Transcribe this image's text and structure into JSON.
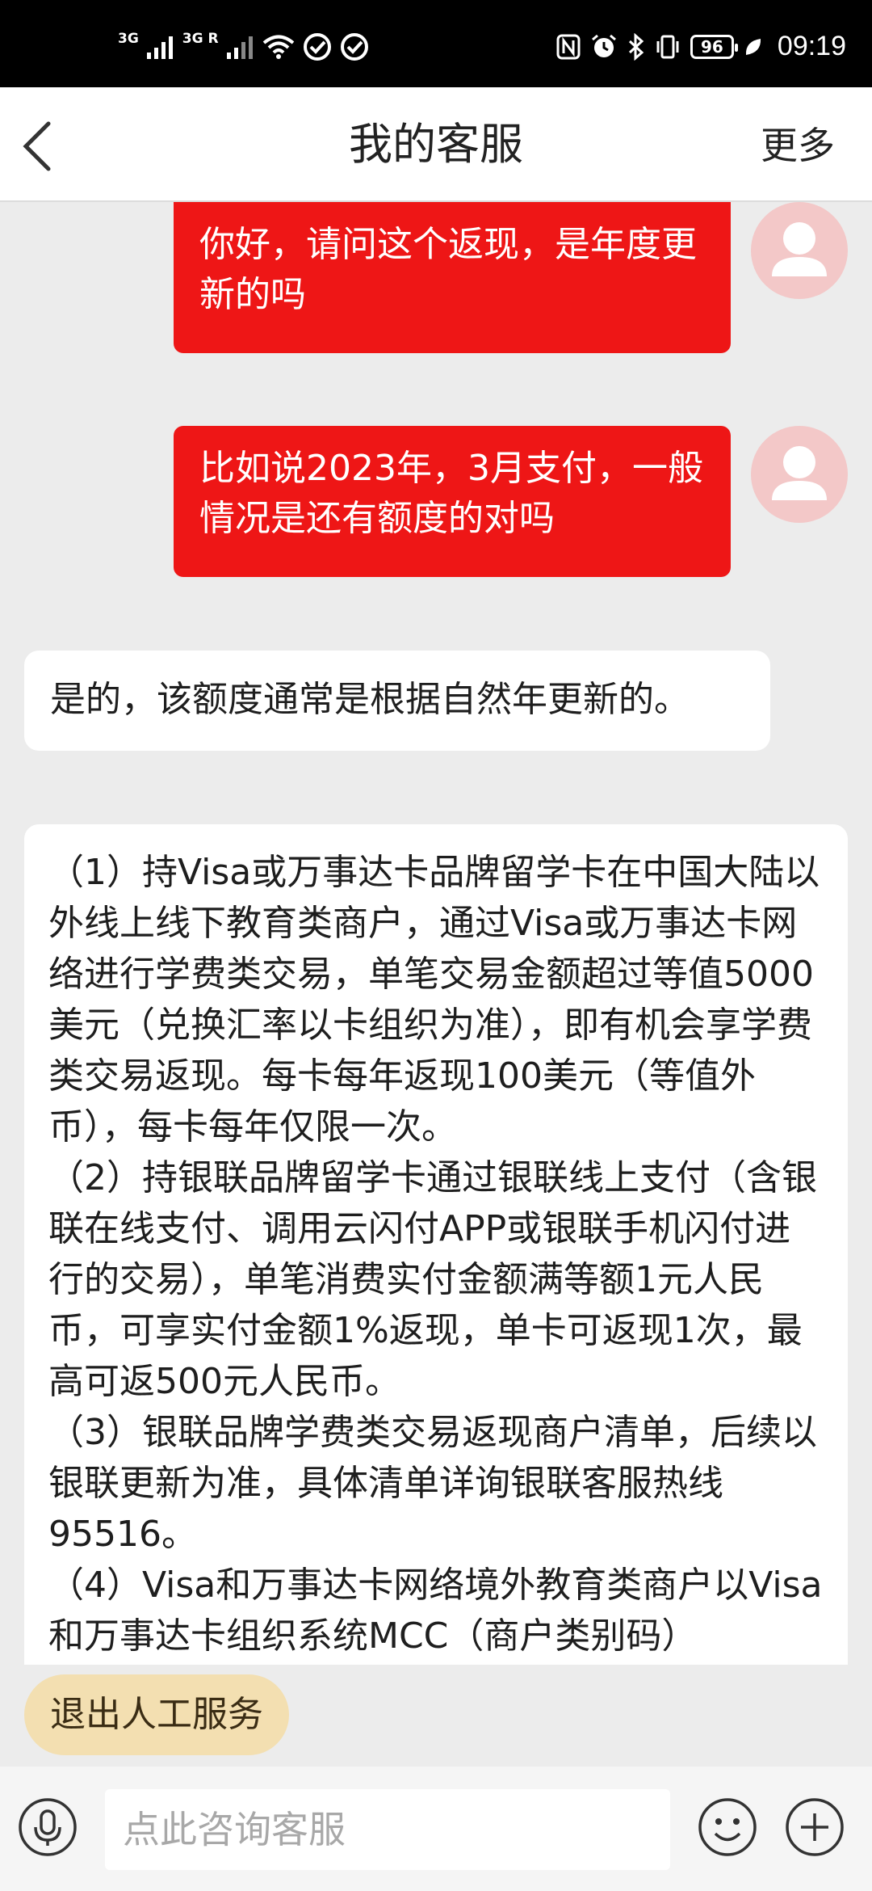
{
  "status_bar": {
    "network_1": "3G",
    "network_2": "3G R",
    "battery": "96",
    "time": "09:19"
  },
  "header": {
    "title": "我的客服",
    "more": "更多"
  },
  "messages": {
    "user_1": "你好，请问这个返现，是年度更新的吗",
    "user_2": "比如说2023年，3月支付，一般情况是还有额度的对吗",
    "agent_1": "是的，该额度通常是根据自然年更新的。",
    "agent_2": {
      "p1": "（1）持Visa或万事达卡品牌留学卡在中国大陆以外线上线下教育类商户，通过Visa或万事达卡网络进行学费类交易，单笔交易金额超过等值5000美元（兑换汇率以卡组织为准），即有机会享学费类交易返现。每卡每年返现100美元（等值外币），每卡每年仅限一次。",
      "p2": "（2）持银联品牌留学卡通过银联线上支付（含银联在线支付、调用云闪付APP或银联手机闪付进行的交易），单笔消费实付金额满等额1元人民币，可享实付金额1%返现，单卡可返现1次，最高可返500元人民币。",
      "p3": "（3）银联品牌学费类交易返现商户清单，后续以银联更新为准，具体清单详询银联客服热线95516。",
      "p4": "（4）Visa和万事达卡网络境外教育类商户以Visa和万事达卡组织系统MCC（商户类别码）"
    }
  },
  "quick_actions": {
    "exit_label": "退出人工服务"
  },
  "input": {
    "placeholder": "点此咨询客服"
  },
  "colors": {
    "user_bubble": "#ee1616",
    "avatar_bg": "#f3c8c8",
    "quick_action_bg": "#f3dfb1"
  }
}
